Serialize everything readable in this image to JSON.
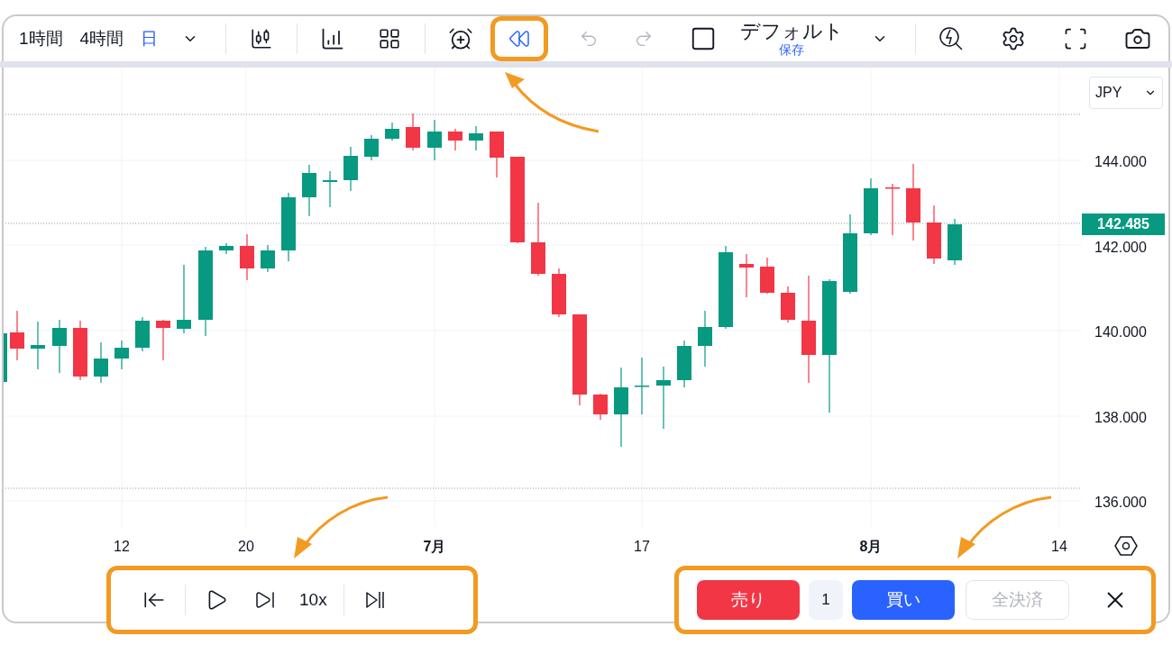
{
  "toolbar": {
    "intervals": [
      {
        "label": "1時間",
        "selected": false
      },
      {
        "label": "4時間",
        "selected": false
      },
      {
        "label": "日",
        "selected": true
      }
    ],
    "layout": {
      "name": "デフォルト",
      "save": "保存"
    }
  },
  "currency": "JPY",
  "price_labels": [
    "144.000",
    "142.000",
    "140.000",
    "138.000",
    "136.000"
  ],
  "current_price": "142.485",
  "date_labels": [
    {
      "label": "12",
      "kind": "day"
    },
    {
      "label": "20",
      "kind": "day"
    },
    {
      "label": "7月",
      "kind": "month"
    },
    {
      "label": "17",
      "kind": "day"
    },
    {
      "label": "8月",
      "kind": "month"
    },
    {
      "label": "14",
      "kind": "day"
    }
  ],
  "replay": {
    "speed": "10x"
  },
  "trade": {
    "sell": "売り",
    "quantity": "1",
    "buy": "買い",
    "close_all": {
      "label": "全決済",
      "disabled": true
    }
  }
}
